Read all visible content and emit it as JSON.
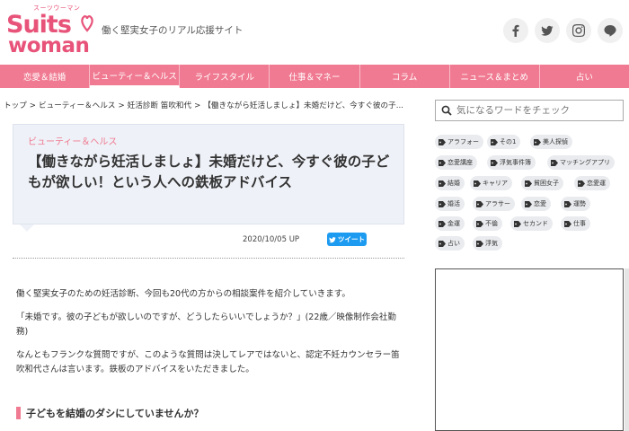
{
  "header": {
    "logo_small": "スーツウーマン",
    "logo_top": "Suits",
    "logo_bottom": "woman",
    "tagline": "働く堅実女子のリアル応援サイト",
    "social_icons": [
      "facebook-icon",
      "twitter-icon",
      "instagram-icon",
      "line-icon"
    ],
    "line_label": "LINE"
  },
  "nav": {
    "items": [
      {
        "label": "恋愛＆結婚"
      },
      {
        "label": "ビューティー＆ヘルス"
      },
      {
        "label": "ライフスタイル"
      },
      {
        "label": "仕事＆マネー"
      },
      {
        "label": "コラム"
      },
      {
        "label": "ニュース＆まとめ"
      },
      {
        "label": "占い"
      }
    ],
    "active_index": 1
  },
  "breadcrumb": {
    "items": [
      "トップ",
      "ビューティー＆ヘルス",
      "妊活診断 笛吹和代",
      "【働きながら妊活しましょ】未婚だけど、今すぐ彼の子..."
    ]
  },
  "article": {
    "category": "ビューティー＆ヘルス",
    "title": "【働きながら妊活しましょ】未婚だけど、今すぐ彼の子どもが欲しい！という人への鉄板アドバイス",
    "date": "2020/10/05 UP",
    "tweet_label": "ツイート",
    "paragraphs": [
      "働く堅実女子のための妊活診断、今回も20代の方からの相談案件を紹介していきます。",
      "「未婚です。彼の子どもが欲しいのですが、どうしたらいいでしょうか？」(22歳／映像制作会社勤務)",
      "なんともフランクな質問ですが、このような質問は決してレアではないと、認定不妊カウンセラー笛吹和代さんは言います。鉄板のアドバイスをいただきました。"
    ],
    "section_heading": "子どもを結婚のダシにしていませんか？"
  },
  "sidebar": {
    "search_placeholder": "気になるワードをチェック",
    "tags": [
      "アラフォー",
      "その1",
      "美人探偵",
      "恋愛講座",
      "浮気事件簿",
      "マッチングアプリ",
      "結婚",
      "キャリア",
      "貧困女子",
      "恋愛運",
      "婚活",
      "アラサー",
      "恋愛",
      "運勢",
      "金運",
      "不倫",
      "セカンド",
      "仕事",
      "占い",
      "浮気"
    ]
  },
  "colors": {
    "brand_pink": "#e8537a",
    "nav_pink": "#f07a91",
    "card_bg": "#eef1f7",
    "twitter_blue": "#1d9bf0"
  }
}
